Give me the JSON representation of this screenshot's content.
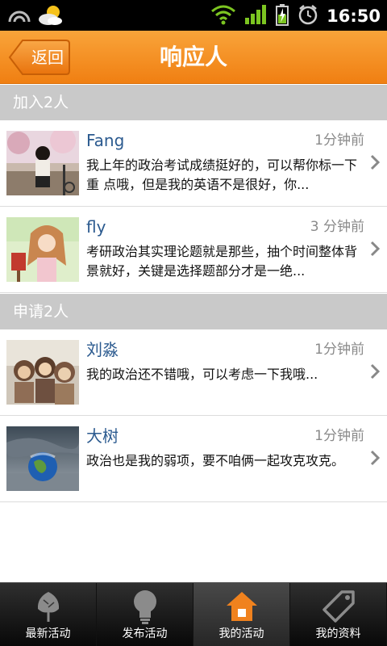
{
  "status_bar": {
    "time": "16:50"
  },
  "header": {
    "back_label": "返回",
    "title": "响应人"
  },
  "sections": [
    {
      "title": "加入2人",
      "items": [
        {
          "name": "Fang",
          "time": "1分钟前",
          "message": "我上年的政治考试成绩挺好的，可以帮你标一下重 点哦，但是我的英语不是很好，你..."
        },
        {
          "name": "fly",
          "time": "3 分钟前",
          "message": "考研政治其实理论题就是那些，抽个时间整体背景就好，关键是选择题部分才是一绝..."
        }
      ]
    },
    {
      "title": "申请2人",
      "items": [
        {
          "name": "刘淼",
          "time": "1分钟前",
          "message": "我的政治还不错哦，可以考虑一下我哦..."
        },
        {
          "name": "大树",
          "time": "1分钟前",
          "message": "政治也是我的弱项，要不咱俩一起攻克攻克。"
        }
      ]
    }
  ],
  "tabs": [
    {
      "label": "最新活动",
      "icon": "leaf-icon",
      "active": false
    },
    {
      "label": "发布活动",
      "icon": "bulb-icon",
      "active": false
    },
    {
      "label": "我的活动",
      "icon": "home-icon",
      "active": true
    },
    {
      "label": "我的资料",
      "icon": "tag-icon",
      "active": false
    }
  ],
  "colors": {
    "header_orange": "#f28a1c",
    "name_blue": "#2b5a8f",
    "active_tab_icon": "#f0821e"
  }
}
